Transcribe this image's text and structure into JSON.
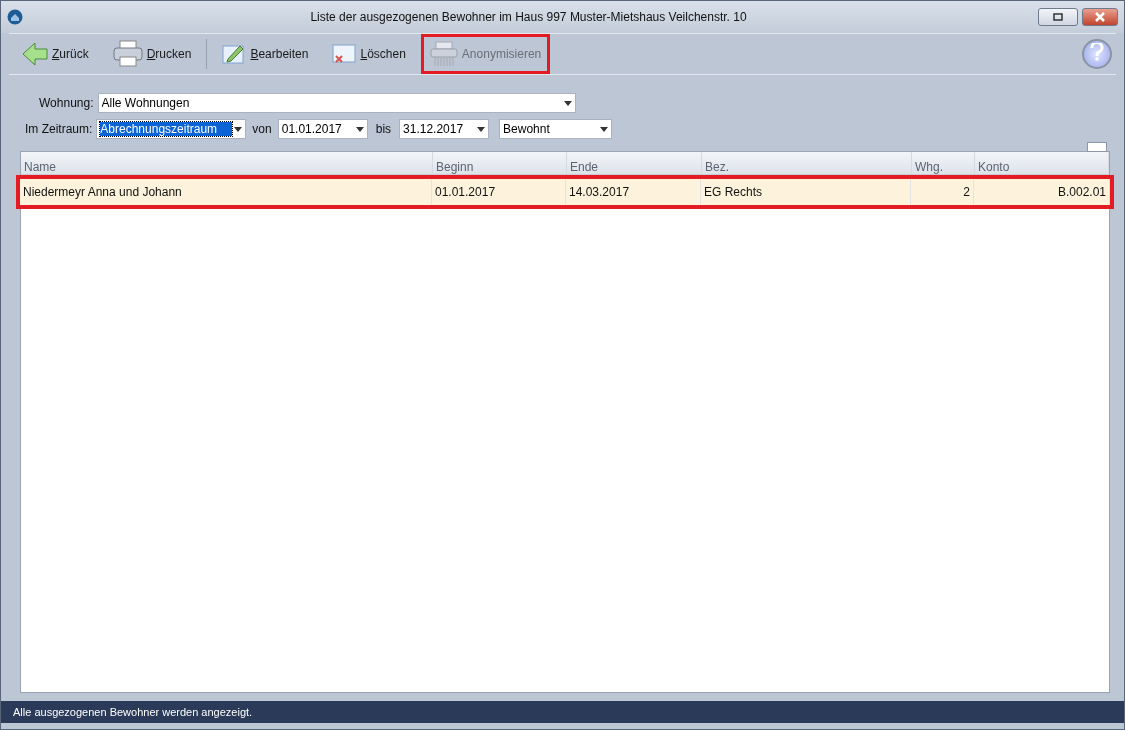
{
  "window": {
    "title": "Liste der ausgezogenen Bewohner im Haus 997  Muster-Mietshaus Veilchenstr. 10"
  },
  "toolbar": [
    {
      "kind": "back",
      "label": "Zurück",
      "underline_first": true,
      "disabled": false,
      "highlighted": false
    },
    {
      "kind": "print",
      "label": "Drucken",
      "underline_first": true,
      "disabled": false,
      "highlighted": false
    },
    {
      "kind": "separator"
    },
    {
      "kind": "edit",
      "label": "Bearbeiten",
      "underline_first": true,
      "disabled": false,
      "highlighted": false
    },
    {
      "kind": "delete",
      "label": "Löschen",
      "underline_first": true,
      "disabled": false,
      "highlighted": false
    },
    {
      "kind": "shredder",
      "label": "Anonymisieren",
      "underline_first": false,
      "disabled": true,
      "highlighted": true
    }
  ],
  "filters": {
    "wohnung_label": "Wohnung:",
    "wohnung_value": "Alle Wohnungen",
    "zeitraum_label": "Im Zeitraum:",
    "zeitraum_value": "Abrechnungszeitraum",
    "zeitraum_focused": true,
    "von_label": "von",
    "von_value": "01.01.2017",
    "bis_label": "bis",
    "bis_value": "31.12.2017",
    "status_value": "Bewohnt"
  },
  "table": {
    "columns": [
      {
        "label": "Name",
        "numeric": false
      },
      {
        "label": "Beginn",
        "numeric": false
      },
      {
        "label": "Ende",
        "numeric": false
      },
      {
        "label": "Bez.",
        "numeric": false
      },
      {
        "label": "Whg.",
        "numeric": true
      },
      {
        "label": "Konto",
        "numeric": true
      }
    ],
    "rows": [
      {
        "cells": [
          "Niedermeyr Anna und Johann",
          "01.01.2017",
          "14.03.2017",
          "EG Rechts",
          "2",
          "B.002.01"
        ],
        "selected": true,
        "highlighted": true
      }
    ]
  },
  "status_bar": "Alle ausgezogenen Bewohner werden angezeigt."
}
